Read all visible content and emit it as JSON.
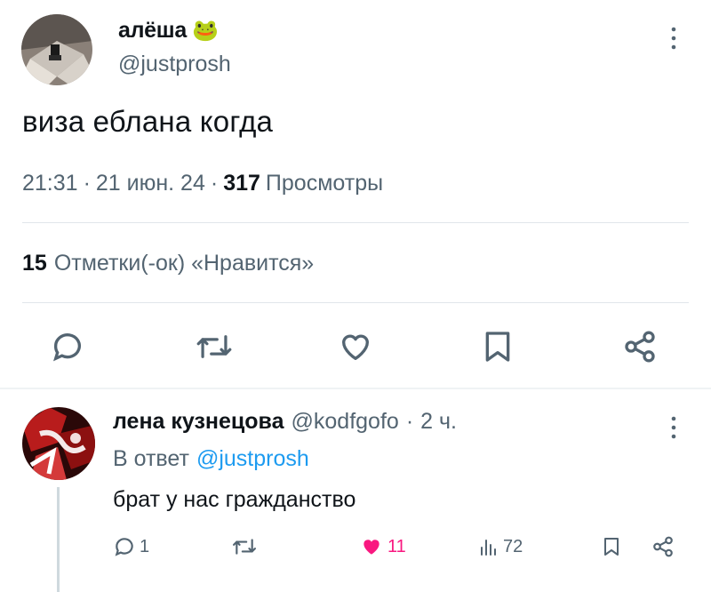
{
  "tweet": {
    "author_name": "алёша",
    "author_emoji": "🐸",
    "author_handle": "@justprosh",
    "text": "виза еблана когда",
    "time": "21:31",
    "date": "21 июн. 24",
    "views_count": "317",
    "views_label": "Просмотры",
    "likes_count": "15",
    "likes_label": "Отметки(-ок) «Нравится»",
    "actions": [
      "reply-icon",
      "retweet-icon",
      "like-icon",
      "bookmark-icon",
      "share-icon"
    ]
  },
  "reply": {
    "author_name": "лена кузнецова",
    "author_handle": "@kodfgofo",
    "age": "2 ч.",
    "in_reply_prefix": "В ответ",
    "in_reply_handle": "@justprosh",
    "text": "брат у нас гражданство",
    "reply_count": "1",
    "like_count": "11",
    "view_count": "72"
  },
  "colors": {
    "text": "#0f1419",
    "muted": "#536471",
    "accent": "#1d9bf0",
    "like": "#f91880",
    "divider": "#e1e6ea"
  }
}
